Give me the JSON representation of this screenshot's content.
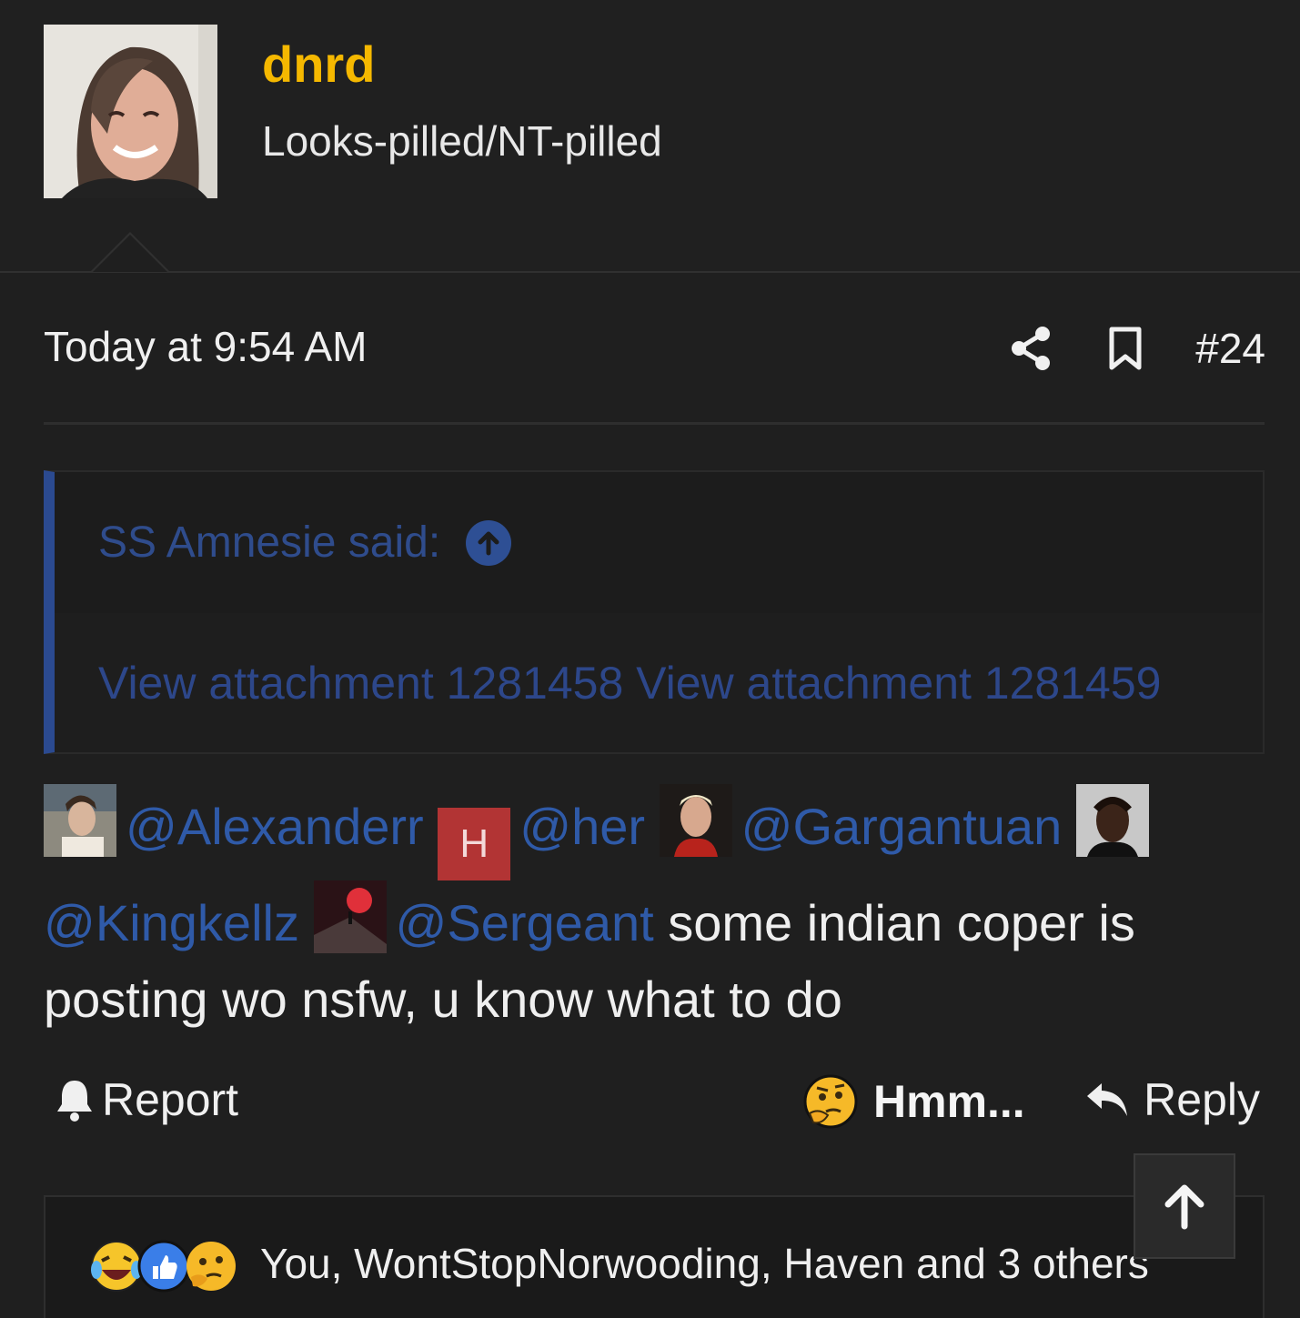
{
  "user": {
    "name": "dnrd",
    "title": "Looks-pilled/NT-pilled",
    "name_color": "#f5b800"
  },
  "post": {
    "time": "Today at 9:54 AM",
    "number": "#24",
    "actions": {
      "share_icon": "share-icon",
      "bookmark_icon": "bookmark-icon"
    }
  },
  "quote": {
    "author": "SS Amnesie said:",
    "body": "View attachment 1281458 View attachment 1281459",
    "accent": "#2b4a90"
  },
  "message": {
    "mentions": [
      "@Alexanderr",
      "@her",
      "@Gargantuan",
      "@Kingkellz",
      "@Sergeant"
    ],
    "letter_avatar": "H",
    "text": "some indian coper is posting wo nsfw, u know what to do"
  },
  "actions": {
    "report": "Report",
    "reaction": "Hmm...",
    "reply": "Reply"
  },
  "reactions": {
    "icons": [
      "laughing-crying-icon",
      "thumbs-up-icon",
      "thinking-icon"
    ],
    "summary": "You, WontStopNorwooding, Haven and 3 others"
  }
}
